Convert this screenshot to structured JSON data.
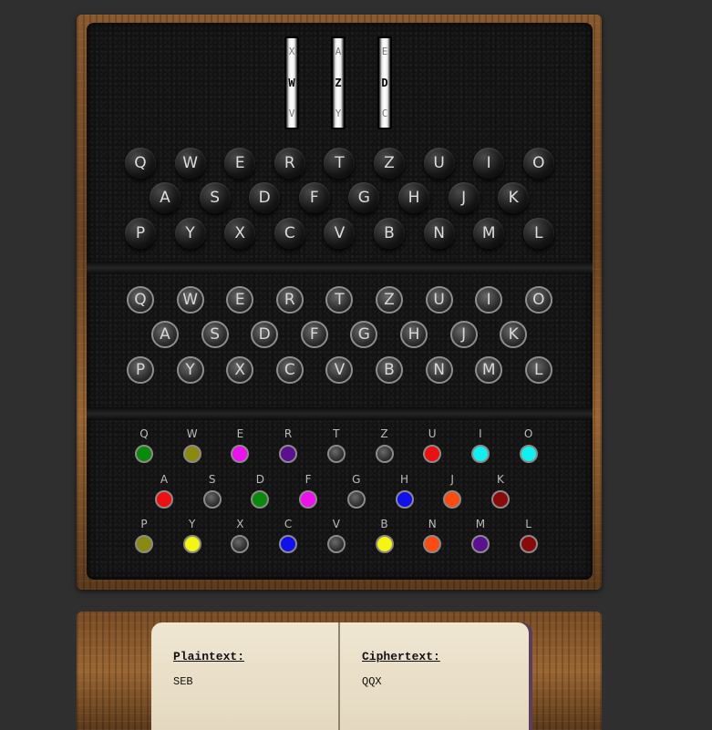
{
  "rotors": [
    {
      "prev": "X",
      "current": "W",
      "next": "V"
    },
    {
      "prev": "A",
      "current": "Z",
      "next": "Y"
    },
    {
      "prev": "E",
      "current": "D",
      "next": "C"
    }
  ],
  "keyboard": {
    "row1": [
      "Q",
      "W",
      "E",
      "R",
      "T",
      "Z",
      "U",
      "I",
      "O"
    ],
    "row2": [
      "A",
      "S",
      "D",
      "F",
      "G",
      "H",
      "J",
      "K"
    ],
    "row3": [
      "P",
      "Y",
      "X",
      "C",
      "V",
      "B",
      "N",
      "M",
      "L"
    ]
  },
  "lampboard": {
    "row1": [
      "Q",
      "W",
      "E",
      "R",
      "T",
      "Z",
      "U",
      "I",
      "O"
    ],
    "row2": [
      "A",
      "S",
      "D",
      "F",
      "G",
      "H",
      "J",
      "K"
    ],
    "row3": [
      "P",
      "Y",
      "X",
      "C",
      "V",
      "B",
      "N",
      "M",
      "L"
    ]
  },
  "plugboard": {
    "row1": [
      {
        "letter": "Q",
        "color": "#0a8a0a"
      },
      {
        "letter": "W",
        "color": "#8a8a10"
      },
      {
        "letter": "E",
        "color": "#ee10ee"
      },
      {
        "letter": "R",
        "color": "#5a1090"
      },
      {
        "letter": "T",
        "color": "none"
      },
      {
        "letter": "Z",
        "color": "none"
      },
      {
        "letter": "U",
        "color": "#ee1010"
      },
      {
        "letter": "I",
        "color": "#10f0f0"
      },
      {
        "letter": "O",
        "color": "#10f0f0"
      }
    ],
    "row2": [
      {
        "letter": "A",
        "color": "#ee1010"
      },
      {
        "letter": "S",
        "color": "none"
      },
      {
        "letter": "D",
        "color": "#0a8a0a"
      },
      {
        "letter": "F",
        "color": "#ee10ee"
      },
      {
        "letter": "G",
        "color": "none"
      },
      {
        "letter": "H",
        "color": "#1010ee"
      },
      {
        "letter": "J",
        "color": "#ff4a10"
      },
      {
        "letter": "K",
        "color": "#8a0a0a"
      }
    ],
    "row3": [
      {
        "letter": "P",
        "color": "#8a8a10"
      },
      {
        "letter": "Y",
        "color": "#f5f510"
      },
      {
        "letter": "X",
        "color": "none"
      },
      {
        "letter": "C",
        "color": "#1010ee"
      },
      {
        "letter": "V",
        "color": "none"
      },
      {
        "letter": "B",
        "color": "#f5f510"
      },
      {
        "letter": "N",
        "color": "#ff4a10"
      },
      {
        "letter": "M",
        "color": "#5a1090"
      },
      {
        "letter": "L",
        "color": "#8a0a0a"
      }
    ]
  },
  "notebook": {
    "plaintext_label": "Plaintext:",
    "plaintext_value": "SEB",
    "ciphertext_label": "Ciphertext:",
    "ciphertext_value": "QQX"
  }
}
